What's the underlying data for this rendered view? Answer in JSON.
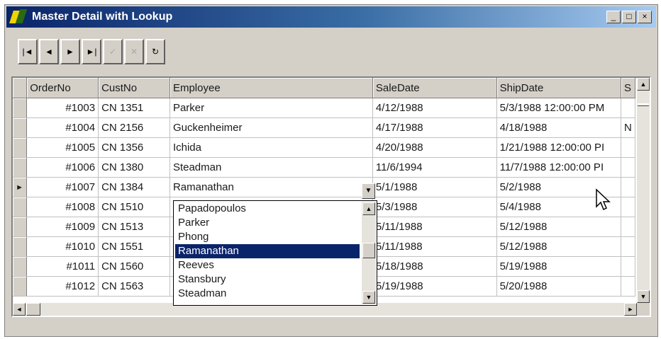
{
  "window": {
    "title": "Master Detail with Lookup",
    "controls": [
      "_",
      "□",
      "×"
    ]
  },
  "navigator": {
    "buttons": [
      {
        "label": "|◄",
        "icon": "first-record-icon",
        "enabled": true
      },
      {
        "label": "◄",
        "icon": "prior-record-icon",
        "enabled": true
      },
      {
        "label": "►",
        "icon": "next-record-icon",
        "enabled": true
      },
      {
        "label": "►|",
        "icon": "last-record-icon",
        "enabled": true
      },
      {
        "label": "✓",
        "icon": "post-checkmark-icon",
        "enabled": false
      },
      {
        "label": "✕",
        "icon": "cancel-x-icon",
        "enabled": false
      },
      {
        "label": "↻",
        "icon": "refresh-icon",
        "enabled": true
      }
    ]
  },
  "grid": {
    "columns": [
      "OrderNo",
      "CustNo",
      "Employee",
      "SaleDate",
      "ShipDate",
      "S"
    ],
    "rows": [
      {
        "order": "#1003",
        "cust": "CN 1351",
        "employee": "Parker",
        "sale": "4/12/1988",
        "ship": "5/3/1988 12:00:00 PM",
        "extra": ""
      },
      {
        "order": "#1004",
        "cust": "CN 2156",
        "employee": "Guckenheimer",
        "sale": "4/17/1988",
        "ship": "4/18/1988",
        "extra": "N"
      },
      {
        "order": "#1005",
        "cust": "CN 1356",
        "employee": "Ichida",
        "sale": "4/20/1988",
        "ship": "1/21/1988 12:00:00 PI",
        "extra": ""
      },
      {
        "order": "#1006",
        "cust": "CN 1380",
        "employee": "Steadman",
        "sale": "11/6/1994",
        "ship": "11/7/1988 12:00:00 PI",
        "extra": ""
      },
      {
        "order": "#1007",
        "cust": "CN 1384",
        "employee": "Ramanathan",
        "sale": "5/1/1988",
        "ship": "5/2/1988",
        "extra": ""
      },
      {
        "order": "#1008",
        "cust": "CN 1510",
        "employee": "",
        "sale": "5/3/1988",
        "ship": "5/4/1988",
        "extra": ""
      },
      {
        "order": "#1009",
        "cust": "CN 1513",
        "employee": "",
        "sale": "5/11/1988",
        "ship": "5/12/1988",
        "extra": ""
      },
      {
        "order": "#1010",
        "cust": "CN 1551",
        "employee": "",
        "sale": "5/11/1988",
        "ship": "5/12/1988",
        "extra": ""
      },
      {
        "order": "#1011",
        "cust": "CN 1560",
        "employee": "",
        "sale": "5/18/1988",
        "ship": "5/19/1988",
        "extra": ""
      },
      {
        "order": "#1012",
        "cust": "CN 1563",
        "employee": "",
        "sale": "5/19/1988",
        "ship": "5/20/1988",
        "extra": ""
      }
    ],
    "current_row_index": 4,
    "current_row_marker": "►"
  },
  "lookup": {
    "items": [
      "Papadopoulos",
      "Parker",
      "Phong",
      "Ramanathan",
      "Reeves",
      "Stansbury",
      "Steadman"
    ],
    "selected": "Ramanathan",
    "dropdown_glyph": "▼"
  },
  "scrollbars": {
    "up": "▲",
    "down": "▼",
    "left": "◄",
    "right": "►"
  },
  "colors": {
    "title_start": "#0a246a",
    "title_end": "#a6caf0",
    "selection": "#0a246a",
    "face": "#d4d0c8"
  }
}
